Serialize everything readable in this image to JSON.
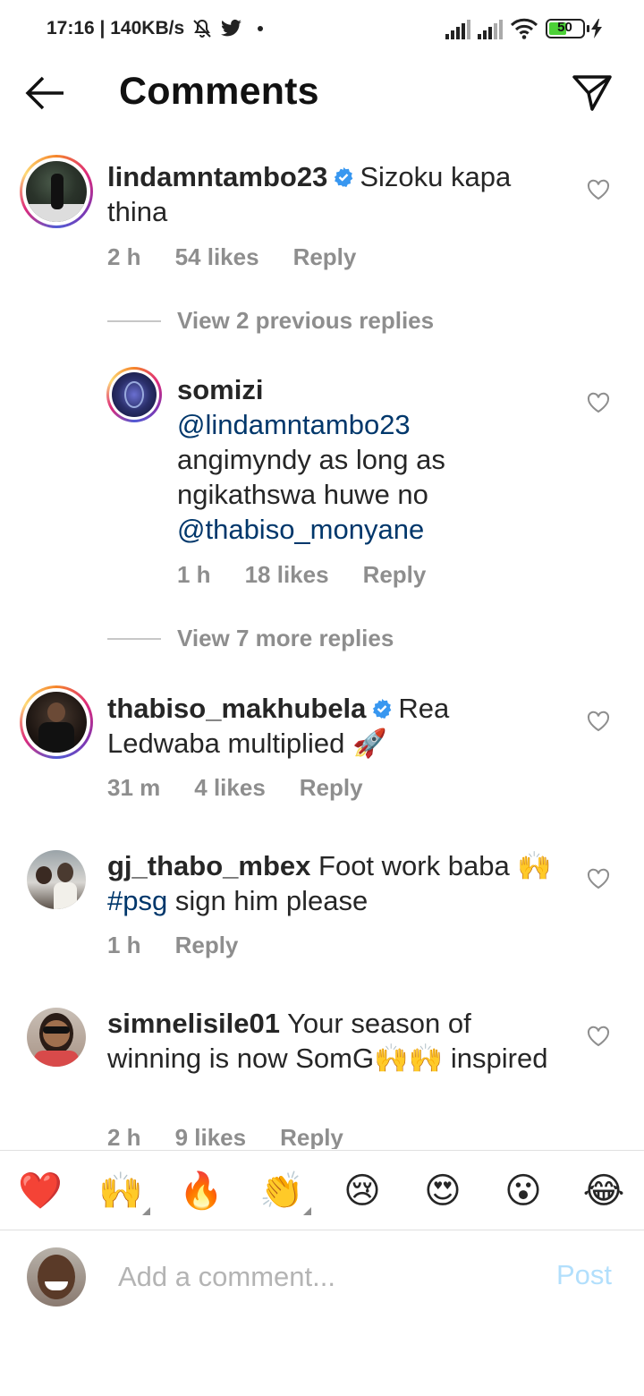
{
  "status_bar": {
    "time_speed": "17:16 | 140KB/s",
    "battery": "50",
    "icons": [
      "mute-icon",
      "twitter-icon",
      "dot-icon",
      "signal-icon",
      "signal-icon",
      "wifi-icon",
      "battery-icon",
      "charging-icon"
    ]
  },
  "header": {
    "title": "Comments",
    "back_icon": "arrow-left-icon",
    "send_icon": "paper-plane-icon"
  },
  "comments": [
    {
      "username": "lindamntambo23",
      "verified": true,
      "text": "Sizoku kapa thina",
      "time": "2 h",
      "likes": "54 likes",
      "reply": "Reply",
      "view_replies": "View 2 previous replies"
    },
    {
      "username": "somizi",
      "mention1": "@lindamntambo23",
      "text": "angimyndy as long as ngikathswa huwe no",
      "mention2": "@thabiso_monyane",
      "time": "1 h",
      "likes": "18 likes",
      "reply": "Reply",
      "view_replies": "View 7 more replies"
    },
    {
      "username": "thabiso_makhubela",
      "verified": true,
      "text": "Rea Ledwaba multiplied",
      "emoji": "🚀",
      "time": "31 m",
      "likes": "4 likes",
      "reply": "Reply"
    },
    {
      "username": "gj_thabo_mbex",
      "text": "Foot work baba",
      "emoji": "🙌",
      "hashtag": "#psg",
      "text2": "sign him please",
      "time": "1 h",
      "reply": "Reply"
    },
    {
      "username": "simnelisile01",
      "text": "Your season of winning is now SomG",
      "emoji": "🙌🙌",
      "text2": "inspired",
      "time": "2 h",
      "likes": "9 likes",
      "reply": "Reply"
    }
  ],
  "emoji_bar": [
    "❤️",
    "🙌",
    "🔥",
    "👏",
    "😢",
    "😍",
    "😮",
    "😂"
  ],
  "add_comment": {
    "placeholder": "Add a comment...",
    "post_label": "Post"
  },
  "colors": {
    "mention": "#00376b",
    "meta": "#8e8e8e",
    "verified": "#3897f0",
    "post_disabled": "#b2dffc"
  }
}
